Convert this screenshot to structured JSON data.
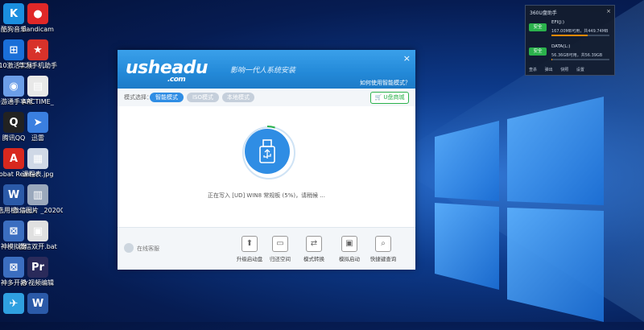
{
  "desktop": {
    "icons": [
      {
        "label": "酷狗音乐",
        "glyph": "K",
        "color": "#1a8fe0"
      },
      {
        "label": "Bandicam",
        "glyph": "●",
        "color": "#e02828"
      },
      {
        "label": "n10激活工具",
        "glyph": "⊞",
        "color": "#1a6fd8"
      },
      {
        "label": "华为手机助手",
        "glyph": "★",
        "color": "#d8322a"
      },
      {
        "label": "手游通手享帮",
        "glyph": "◉",
        "color": "#6c9ee8"
      },
      {
        "label": "ARCTIME_",
        "glyph": "▤",
        "color": "#e8e8e8"
      },
      {
        "label": "腾讯QQ",
        "glyph": "Q",
        "color": "#222222"
      },
      {
        "label": "迅雷",
        "glyph": "➤",
        "color": "#3a7fe0"
      },
      {
        "label": "Acrobat Reader DC",
        "glyph": "A",
        "color": "#d8281e"
      },
      {
        "label": "课程表.jpg",
        "glyph": "▦",
        "color": "#cfd8e6"
      },
      {
        "label": "A 选用机 .docx",
        "glyph": "W",
        "color": "#2b5aa8"
      },
      {
        "label": "微信图片 _2020090...",
        "glyph": "▥",
        "color": "#9aa8bc"
      },
      {
        "label": "神模拟器",
        "glyph": "⊠",
        "color": "#3b6ec0"
      },
      {
        "label": "微信双开.bat",
        "glyph": "▣",
        "color": "#e0e0e0"
      },
      {
        "label": "神多开器",
        "glyph": "⊠",
        "color": "#3b6ec0"
      },
      {
        "label": "Pr视频编辑",
        "glyph": "Pr",
        "color": "#2a2a5a"
      },
      {
        "label": "",
        "glyph": "✈",
        "color": "#2fa0e0"
      },
      {
        "label": "",
        "glyph": "W",
        "color": "#2b5aa8"
      }
    ]
  },
  "app": {
    "logo_text": "usheadu",
    "logo_sub": ".com",
    "slogan": "影响一代人系统安装",
    "close_glyph": "×",
    "help_link": "如何使用智能模式？",
    "mode_label": "模式选择：",
    "tabs": [
      "智能模式",
      "ISO模式",
      "本地模式"
    ],
    "shop_button": "U盘商城",
    "status_text": "正在写入 [UD] WIN8 常规板 (5%)，请稍候 ...",
    "progress_percent": 5,
    "online_service": "在线客服",
    "tools": [
      {
        "label": "升级启动盘",
        "glyph": "⬆"
      },
      {
        "label": "归还空间",
        "glyph": "▭"
      },
      {
        "label": "模式转换",
        "glyph": "⇄"
      },
      {
        "label": "模拟启动",
        "glyph": "▣"
      },
      {
        "label": "快捷键查询",
        "glyph": "⌕"
      }
    ]
  },
  "widget360": {
    "title": "360U盘助手",
    "close_glyph": "×",
    "drives": [
      {
        "badge": "安全",
        "name": "EFI(J:)",
        "info": "167.00MB可用，共449.74MB",
        "used_fraction": 0.63
      },
      {
        "badge": "安全",
        "name": "DATA(L:)",
        "info": "56.36GB可用，共56.39GB",
        "used_fraction": 0.01
      }
    ],
    "actions": [
      "查杀",
      "弹出",
      "快照",
      "设置"
    ]
  },
  "colors": {
    "accent": "#2f8de4",
    "tab_active": "#2f8de4",
    "tab_inactive": "#c5cfdb",
    "shop_green": "#2bb24c"
  }
}
